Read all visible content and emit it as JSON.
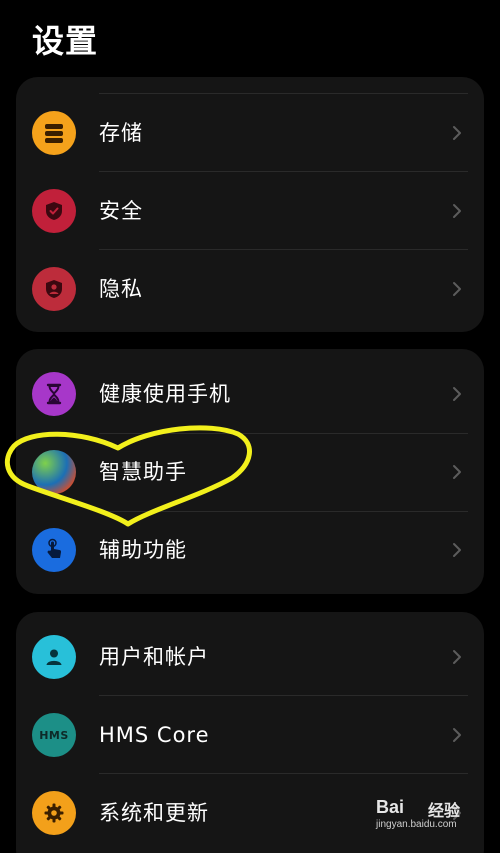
{
  "page": {
    "title": "设置"
  },
  "groups": [
    {
      "items": [
        {
          "label": "存储",
          "icon": "storage-icon",
          "color": "#f5a21b"
        },
        {
          "label": "安全",
          "icon": "shield-check-icon",
          "color": "#c1203a"
        },
        {
          "label": "隐私",
          "icon": "privacy-shield-icon",
          "color": "#bd2c3b"
        }
      ]
    },
    {
      "items": [
        {
          "label": "健康使用手机",
          "icon": "hourglass-icon",
          "color": "#a737c9"
        },
        {
          "label": "智慧助手",
          "icon": "assistant-icon",
          "color": "#1c6fb5"
        },
        {
          "label": "辅助功能",
          "icon": "hand-pointer-icon",
          "color": "#1a6cdf"
        }
      ]
    },
    {
      "items": [
        {
          "label": "用户和帐户",
          "icon": "user-icon",
          "color": "#28c0d9"
        },
        {
          "label": "HMS Core",
          "icon": "hms-icon",
          "icon_text": "HMS",
          "color": "#1c8f87"
        },
        {
          "label": "系统和更新",
          "icon": "gear-icon",
          "color": "#f3a01a"
        }
      ]
    }
  ],
  "annotation": {
    "color": "#f2f01c",
    "shape": "heart"
  },
  "watermark": {
    "brand": "Bai",
    "cn": "经验",
    "url": "jingyan.baidu.com"
  }
}
